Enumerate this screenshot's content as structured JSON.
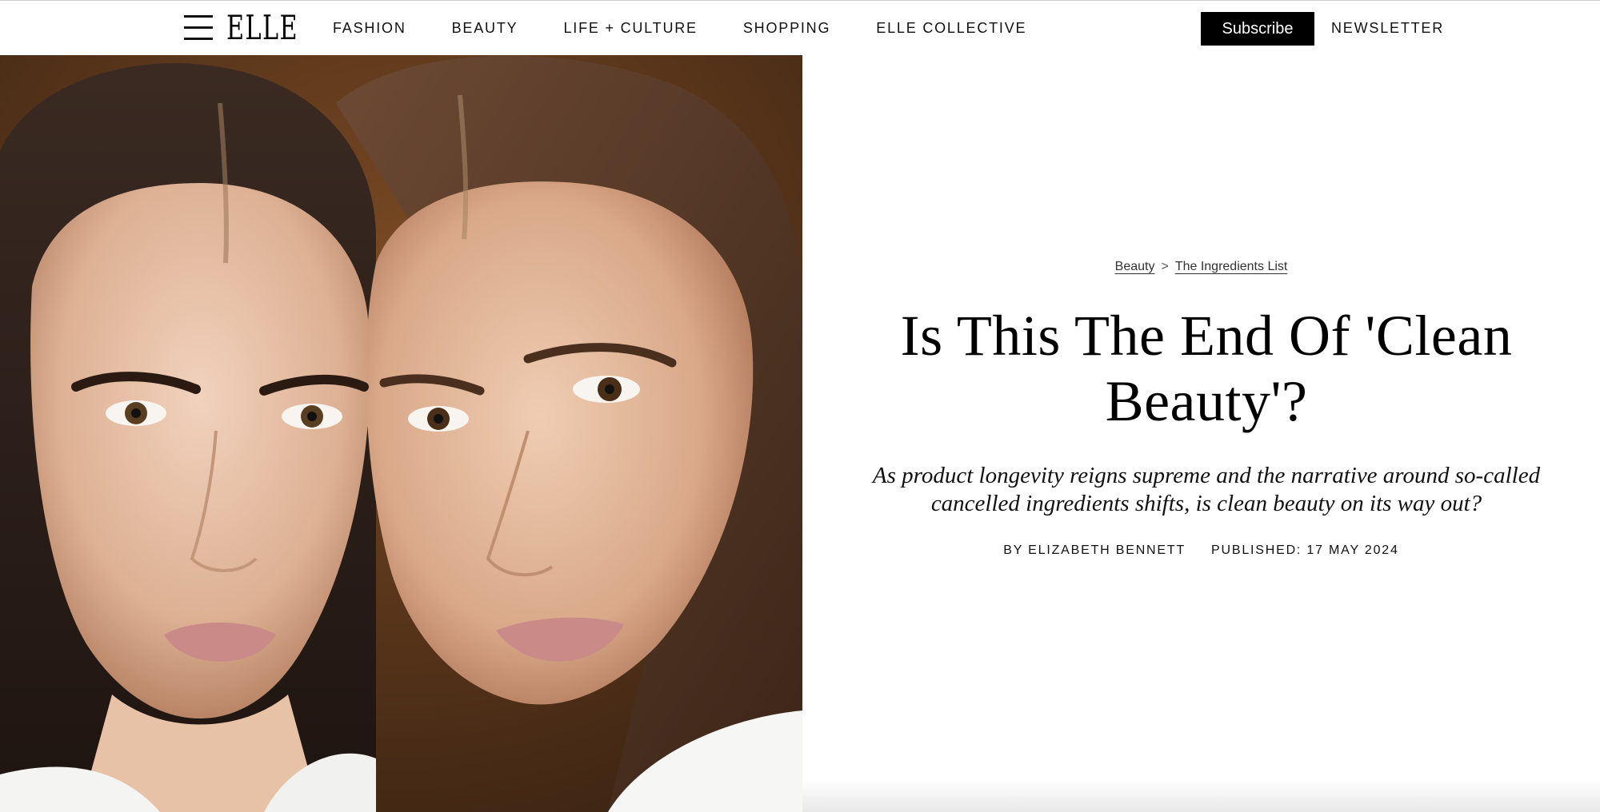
{
  "header": {
    "logo": "ELLE",
    "nav": [
      "FASHION",
      "BEAUTY",
      "LIFE + CULTURE",
      "SHOPPING",
      "ELLE COLLECTIVE"
    ],
    "subscribe_label": "Subscribe",
    "newsletter_label": "NEWSLETTER",
    "menu_icon": "hamburger-menu-icon"
  },
  "hero": {
    "image_alt": "Close-up portrait of two models with natural makeup, heads together"
  },
  "article": {
    "breadcrumb": [
      "Beauty",
      "The Ingredients List"
    ],
    "breadcrumb_separator": ">",
    "title": "Is This The End Of 'Clean Beauty'?",
    "dek": "As product longevity reigns supreme and the narrative around so-called cancelled ingredients shifts, is clean beauty on its way out?",
    "byline": "BY ELIZABETH BENNETT",
    "published": "PUBLISHED: 17 MAY 2024"
  },
  "colors": {
    "brand_black": "#000000",
    "background": "#ffffff"
  }
}
